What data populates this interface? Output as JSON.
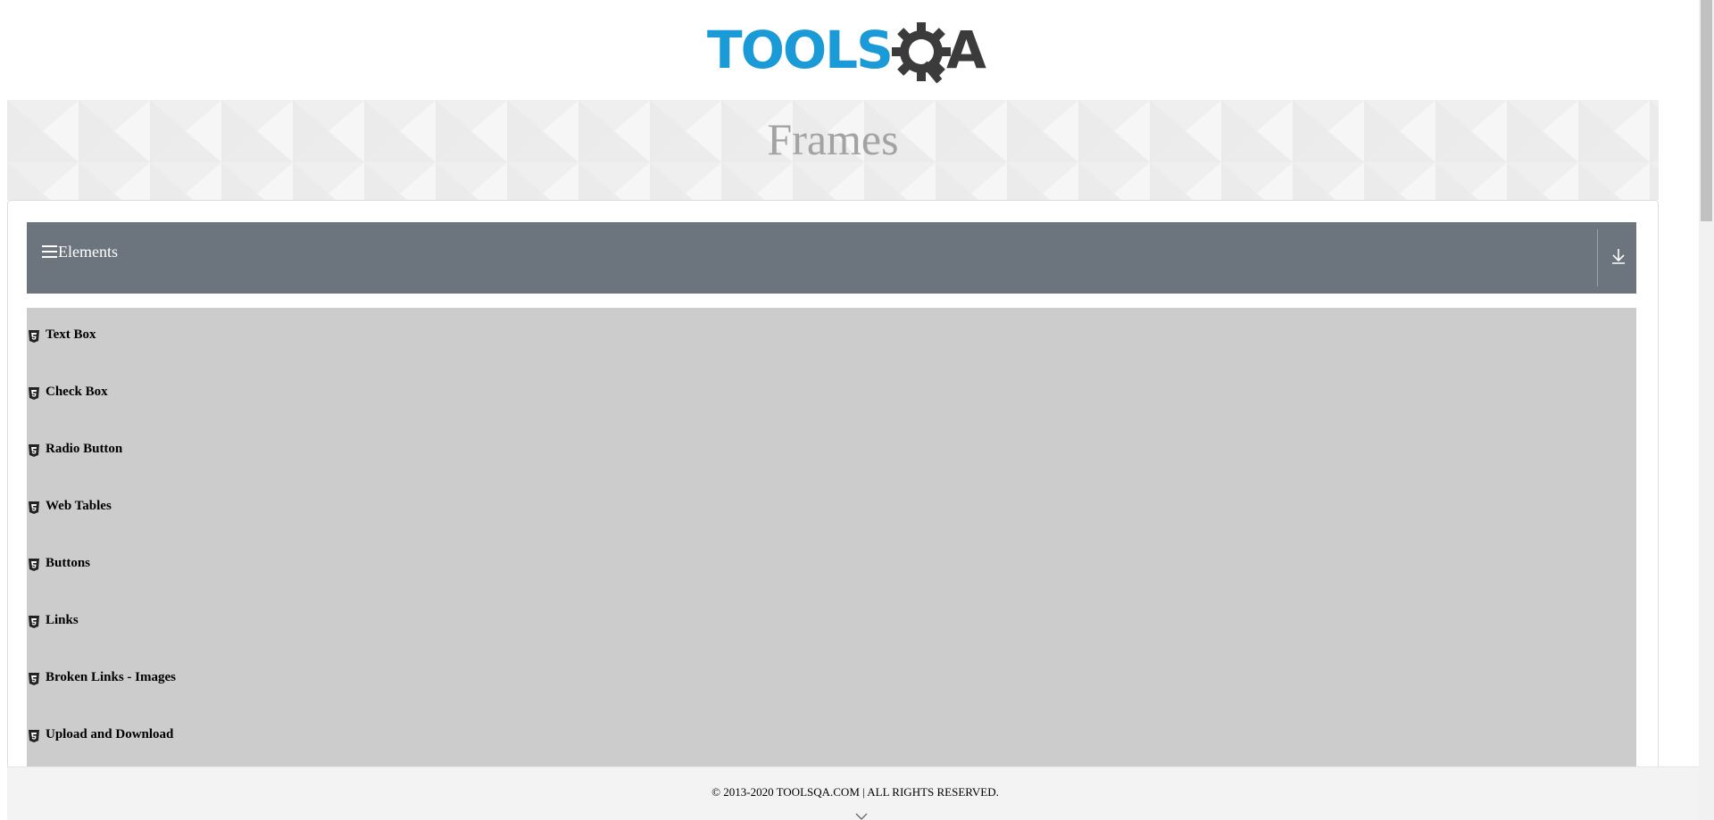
{
  "header": {
    "logo_text_left": "TOOLS",
    "logo_text_right": "A",
    "logo_colors": {
      "tools": "#1a9ad6",
      "qa": "#3b3b3b"
    }
  },
  "banner": {
    "title": "Frames"
  },
  "sidebar": {
    "group": {
      "title": "Elements",
      "menu_icon": "hamburger-icon",
      "collapse_icon": "download-arrow-icon"
    },
    "items": [
      {
        "label": "Text Box",
        "icon": "html5-icon"
      },
      {
        "label": "Check Box",
        "icon": "html5-icon"
      },
      {
        "label": "Radio Button",
        "icon": "html5-icon"
      },
      {
        "label": "Web Tables",
        "icon": "html5-icon"
      },
      {
        "label": "Buttons",
        "icon": "html5-icon"
      },
      {
        "label": "Links",
        "icon": "html5-icon"
      },
      {
        "label": "Broken Links - Images",
        "icon": "html5-icon"
      },
      {
        "label": "Upload and Download",
        "icon": "html5-icon"
      }
    ]
  },
  "footer": {
    "copyright": "© 2013-2020 TOOLSQA.COM | ALL RIGHTS RESERVED.",
    "chevron_icon": "chevron-down-icon"
  },
  "colors": {
    "group_header_bg": "#6c757d",
    "menu_bg": "#cccccc",
    "banner_title": "#a3a3a3",
    "footer_bg": "#f3f3f3"
  }
}
